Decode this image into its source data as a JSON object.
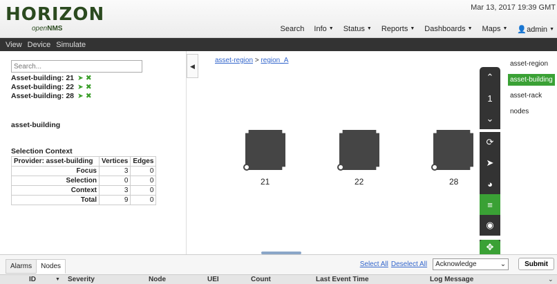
{
  "header": {
    "logo_main": "HORIZON",
    "logo_sub_italic": "open",
    "logo_sub_bold": "NMS",
    "timestamp": "Mar 13, 2017 19:39 GMT",
    "nav": [
      "Search",
      "Info",
      "Status",
      "Reports",
      "Dashboards",
      "Maps",
      "admin"
    ]
  },
  "menubar": [
    "View",
    "Device",
    "Simulate"
  ],
  "left": {
    "search_placeholder": "Search...",
    "buildings": [
      "Asset-building: 21",
      "Asset-building: 22",
      "Asset-building: 28"
    ],
    "selected_layer": "asset-building",
    "selection_context_title": "Selection Context",
    "table": {
      "headers": [
        "Provider: asset-building",
        "Vertices",
        "Edges"
      ],
      "rows": [
        {
          "label": "Focus",
          "vertices": "3",
          "edges": "0"
        },
        {
          "label": "Selection",
          "vertices": "0",
          "edges": "0"
        },
        {
          "label": "Context",
          "vertices": "3",
          "edges": "0"
        },
        {
          "label": "Total",
          "vertices": "9",
          "edges": "0"
        }
      ]
    }
  },
  "breadcrumb": {
    "root": "asset-region",
    "sep": ">",
    "child": "region_A"
  },
  "graph": {
    "nodes": [
      "21",
      "22",
      "28"
    ]
  },
  "toolbar": {
    "icons": [
      "chevron-up-icon",
      "semantic-zoom-level",
      "chevron-down-icon",
      "refresh-icon",
      "location-arrow-icon",
      "globe-icon",
      "menu-icon",
      "eye-icon",
      "move-icon"
    ],
    "zoom_level": "1"
  },
  "layers": {
    "items": [
      "asset-region",
      "asset-building",
      "asset-rack",
      "nodes"
    ],
    "selected": "asset-building"
  },
  "bottom": {
    "tabs": [
      "Alarms",
      "Nodes"
    ],
    "select_all": "Select All",
    "deselect_all": "Deselect All",
    "action_value": "Acknowledge",
    "submit": "Submit",
    "columns": [
      "ID",
      "Severity",
      "Node",
      "UEI",
      "Count",
      "Last Event Time",
      "Log Message"
    ]
  }
}
